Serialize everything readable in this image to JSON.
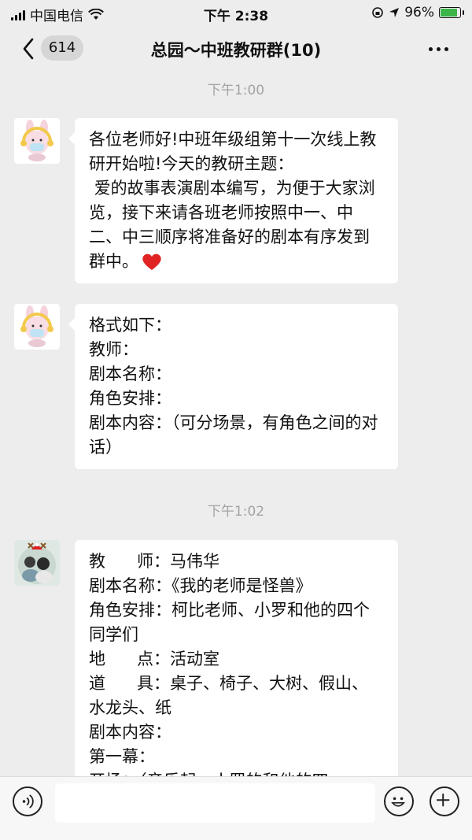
{
  "status_bar": {
    "carrier": "中国电信",
    "time": "下午 2:38",
    "battery_percent": "96%",
    "battery_level": 0.96
  },
  "nav": {
    "unread_count": "614",
    "title": "总园～中班教研群(10)"
  },
  "messages": [
    {
      "time": "下午1:00",
      "text": "各位老师好!中班年级组第十一次线上教研开始啦!今天的教研主题：\n 爱的故事表演剧本编写，为便于大家浏览，接下来请各班老师按照中一、中二、中三顺序将准备好的剧本有序发到群中。",
      "emoji": "heart-emoji"
    },
    {
      "text": "格式如下：\n教师：\n剧本名称：\n角色安排：\n剧本内容：（可分场景，有角色之间的对话）"
    },
    {
      "time": "下午1:02",
      "text": "教      师：马伟华\n剧本名称：《我的老师是怪兽》\n角色安排：柯比老师、小罗和他的四个同学们\n地      点：活动室\n道      具：桌子、椅子、大树、假山、水龙头、纸\n剧本内容：\n第一幕：\n开场：（音乐起，小罗的和他的四"
    }
  ],
  "colors": {
    "background": "#ededed",
    "bubble": "#ffffff",
    "time_text": "#a3a3a3",
    "battery_green": "#3bb54a"
  },
  "icons": [
    "signal-icon",
    "wifi-icon",
    "lock-rotation-icon",
    "location-icon",
    "battery-icon",
    "back-chevron-icon",
    "more-icon",
    "voice-icon",
    "emoji-icon",
    "plus-icon"
  ]
}
